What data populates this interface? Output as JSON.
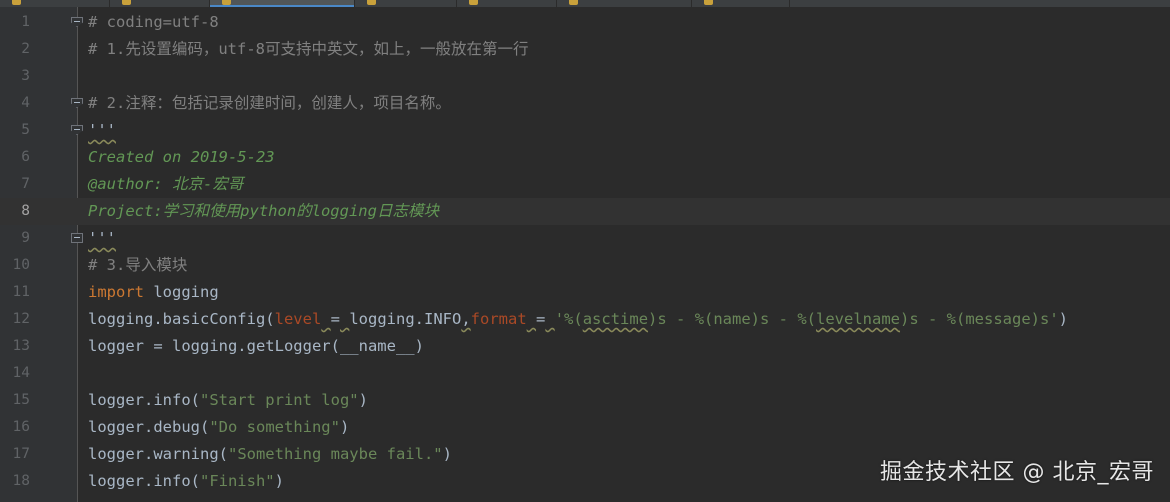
{
  "editor": {
    "current_line": 8,
    "lines": [
      {
        "num": "1",
        "fold": "open",
        "tokens": [
          {
            "t": "# coding=utf-8",
            "c": "comment"
          }
        ]
      },
      {
        "num": "2",
        "fold": null,
        "tokens": [
          {
            "t": "# 1.先设置编码，utf-8可支持中英文，如上，一般放在第一行",
            "c": "comment"
          }
        ]
      },
      {
        "num": "3",
        "fold": null,
        "tokens": []
      },
      {
        "num": "4",
        "fold": "open",
        "tokens": [
          {
            "t": "# 2.注释：包括记录创建时间，创建人，项目名称。",
            "c": "comment"
          }
        ]
      },
      {
        "num": "5",
        "fold": "open",
        "tokens": [
          {
            "t": "'''",
            "c": "doc-underline"
          }
        ]
      },
      {
        "num": "6",
        "fold": null,
        "tokens": [
          {
            "t": "Created on 2019-5-23",
            "c": "doc"
          }
        ]
      },
      {
        "num": "7",
        "fold": null,
        "tokens": [
          {
            "t": "@author: 北京-宏哥",
            "c": "doc"
          }
        ]
      },
      {
        "num": "8",
        "fold": null,
        "tokens": [
          {
            "t": "Project:学习和使用python的logging日志模块",
            "c": "doc"
          }
        ]
      },
      {
        "num": "9",
        "fold": "close",
        "tokens": [
          {
            "t": "'''",
            "c": "doc-underline"
          }
        ]
      },
      {
        "num": "10",
        "fold": null,
        "tokens": [
          {
            "t": "# 3.导入模块",
            "c": "comment"
          }
        ]
      },
      {
        "num": "11",
        "fold": null,
        "tokens": [
          {
            "t": "import",
            "c": "keyword"
          },
          {
            "t": " logging",
            "c": "plain"
          }
        ]
      },
      {
        "num": "12",
        "fold": null,
        "tokens": [
          {
            "t": "logging.basicConfig(",
            "c": "plain"
          },
          {
            "t": "level",
            "c": "param"
          },
          {
            "t": " ",
            "c": "underline"
          },
          {
            "t": "=",
            "c": "plain"
          },
          {
            "t": " ",
            "c": "underline"
          },
          {
            "t": "logging.INFO",
            "c": "plain"
          },
          {
            "t": ",",
            "c": "underline"
          },
          {
            "t": "format",
            "c": "param"
          },
          {
            "t": " ",
            "c": "underline"
          },
          {
            "t": "=",
            "c": "plain"
          },
          {
            "t": " ",
            "c": "underline"
          },
          {
            "t": "'%(",
            "c": "string"
          },
          {
            "t": "asctime",
            "c": "string underline"
          },
          {
            "t": ")s - %(name)s - %(",
            "c": "string"
          },
          {
            "t": "levelname",
            "c": "string underline"
          },
          {
            "t": ")s - %(message)s'",
            "c": "string"
          },
          {
            "t": ")",
            "c": "plain"
          }
        ]
      },
      {
        "num": "13",
        "fold": null,
        "tokens": [
          {
            "t": "logger = logging.getLogger(__name__)",
            "c": "plain"
          }
        ]
      },
      {
        "num": "14",
        "fold": null,
        "tokens": []
      },
      {
        "num": "15",
        "fold": null,
        "tokens": [
          {
            "t": "logger.info(",
            "c": "plain"
          },
          {
            "t": "\"Start print log\"",
            "c": "string"
          },
          {
            "t": ")",
            "c": "plain"
          }
        ]
      },
      {
        "num": "16",
        "fold": null,
        "tokens": [
          {
            "t": "logger.debug(",
            "c": "plain"
          },
          {
            "t": "\"Do something\"",
            "c": "string"
          },
          {
            "t": ")",
            "c": "plain"
          }
        ]
      },
      {
        "num": "17",
        "fold": null,
        "tokens": [
          {
            "t": "logger.warning(",
            "c": "plain"
          },
          {
            "t": "\"Something maybe fail.\"",
            "c": "string"
          },
          {
            "t": ")",
            "c": "plain"
          }
        ]
      },
      {
        "num": "18",
        "fold": null,
        "tokens": [
          {
            "t": "logger.info(",
            "c": "plain"
          },
          {
            "t": "\"Finish\"",
            "c": "string"
          },
          {
            "t": ")",
            "c": "plain"
          }
        ]
      }
    ]
  },
  "watermark": "掘金技术社区 @ 北京_宏哥",
  "colors": {
    "background": "#2b2b2b",
    "gutter": "#313335",
    "comment": "#808080",
    "docstring": "#629755",
    "keyword": "#cc7832",
    "string": "#6a8759",
    "param": "#aa4926",
    "text": "#a9b7c6"
  }
}
